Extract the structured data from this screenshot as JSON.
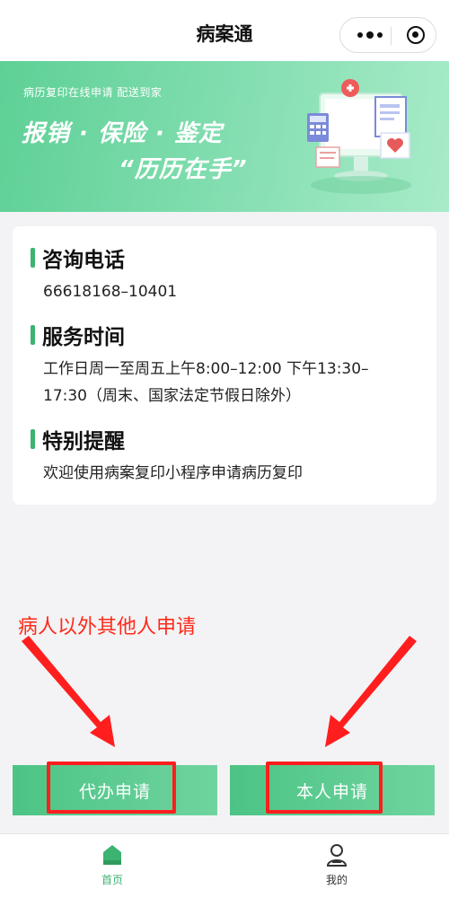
{
  "nav": {
    "title": "病案通"
  },
  "banner": {
    "subtitle": "病历复印在线申请 配送到家",
    "headline": "报销 · 保险 · 鉴定",
    "quote": "“历历在手”"
  },
  "info": {
    "consult": {
      "title": "咨询电话",
      "text": "66618168–10401"
    },
    "service": {
      "title": "服务时间",
      "line1": "工作日周一至周五上午8:00–12:00 下午13:30–",
      "line2": "17:30（周末、国家法定节假日除外）"
    },
    "notice": {
      "title": "特别提醒",
      "text": "欢迎使用病案复印小程序申请病历复印"
    }
  },
  "annotation": {
    "text": "病人以外其他人申请",
    "color": "#ff2a1a"
  },
  "actions": {
    "proxy_label": "代办申请",
    "self_label": "本人申请"
  },
  "tabbar": {
    "home_label": "首页",
    "mine_label": "我的",
    "active_color": "#3cb371"
  },
  "icons": {
    "more": "more-dots-icon",
    "close": "target-close-icon",
    "home": "home-icon",
    "user": "user-icon"
  }
}
